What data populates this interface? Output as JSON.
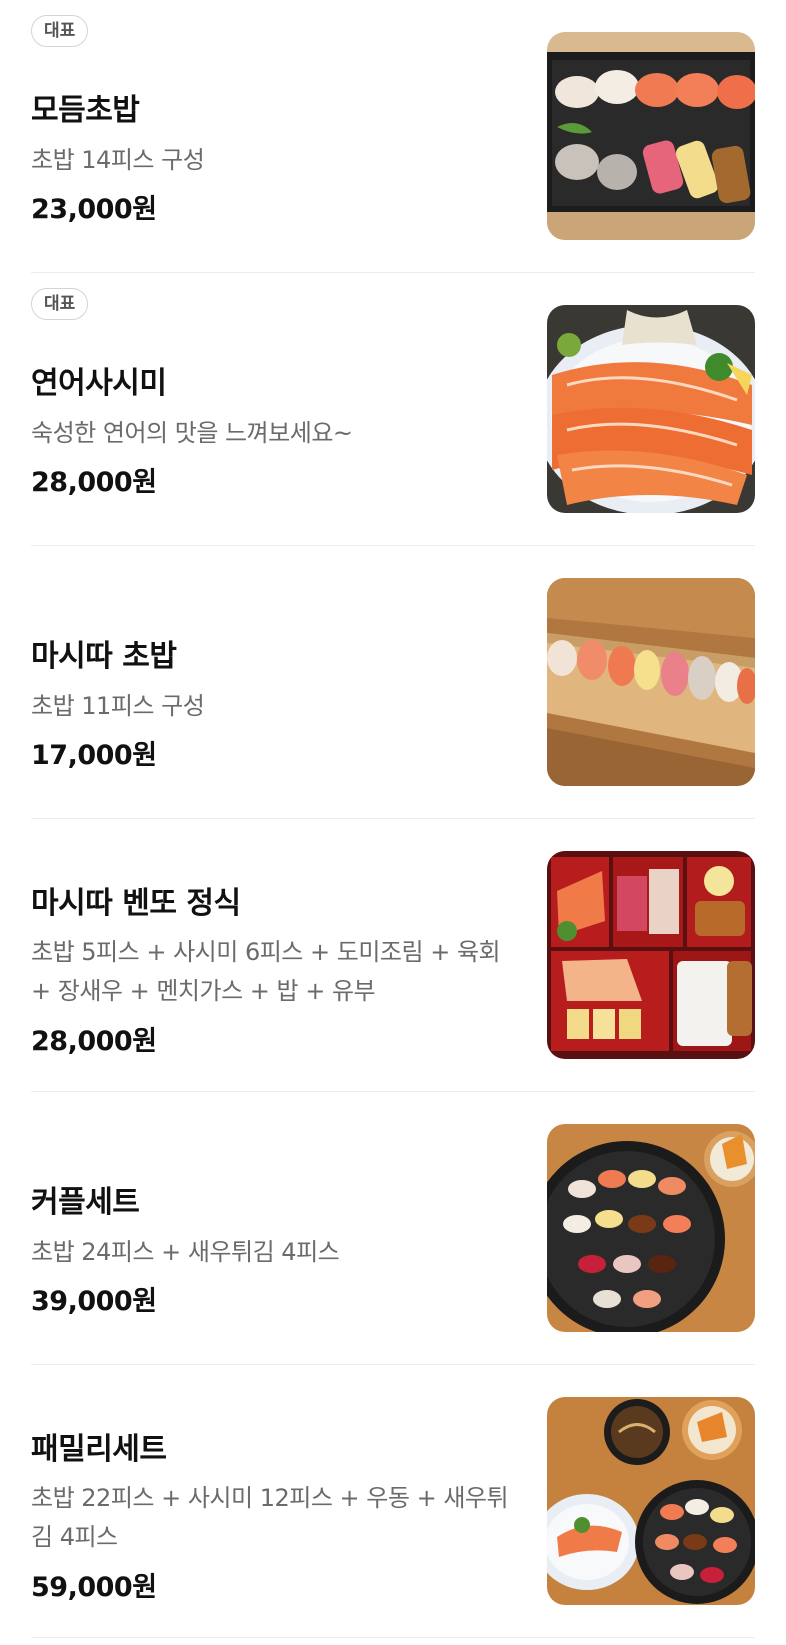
{
  "menu": {
    "items": [
      {
        "badge": "대표",
        "name": "모듬초밥",
        "description": "초밥 14피스 구성",
        "price": "23,000원",
        "image": "assorted-sushi-photo"
      },
      {
        "badge": "대표",
        "name": "연어사시미",
        "description": "숙성한 연어의 맛을 느껴보세요~",
        "price": "28,000원",
        "image": "salmon-sashimi-photo"
      },
      {
        "name": "마시따 초밥",
        "description": "초밥 11피스 구성",
        "price": "17,000원",
        "image": "sushi-board-photo"
      },
      {
        "name": "마시따 벤또 정식",
        "description": "초밥 5피스 + 사시미 6피스 + 도미조림 + 육회 + 장새우 + 멘치가스 + 밥 + 유부",
        "price": "28,000원",
        "image": "bento-box-photo"
      },
      {
        "name": "커플세트",
        "description": "초밥 24피스 + 새우튀김 4피스",
        "price": "39,000원",
        "image": "couple-set-photo"
      },
      {
        "name": "패밀리세트",
        "description": "초밥 22피스 + 사시미 12피스 + 우동 + 새우튀김 4피스",
        "price": "59,000원",
        "image": "family-set-photo"
      }
    ]
  },
  "colors": {
    "text_primary": "#111111",
    "text_secondary": "#6b6b6b",
    "badge_border": "#d4d4d4",
    "divider": "#ececec"
  }
}
